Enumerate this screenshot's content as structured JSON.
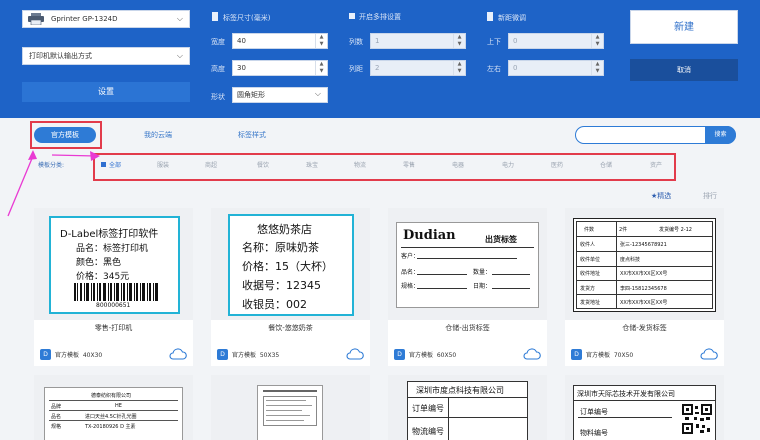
{
  "top": {
    "printer": "Gprinter  GP-1324D",
    "print_mode": "打印机默认输出方式",
    "settings_button": "设置",
    "size_heading": "标签尺寸(毫米)",
    "width_label": "宽度",
    "width_value": "40",
    "height_label": "高度",
    "height_value": "30",
    "shape_label": "形状",
    "shape_value": "圆角矩形",
    "multi_heading": "开启多排设置",
    "cols_label": "列数",
    "cols_value": "1",
    "colgap_label": "列距",
    "colgap_value": "2",
    "offset_heading": "新距微调",
    "ud_label": "上下",
    "ud_value": "0",
    "lr_label": "左右",
    "lr_value": "0",
    "new_button": "新建",
    "cancel_button": "取消"
  },
  "tabs": {
    "official": "官方模板",
    "cloud": "我的云端",
    "tag_rules": "标签样式"
  },
  "search": {
    "button": "搜索"
  },
  "categories": {
    "label": "模板分类:",
    "items": [
      "全部",
      "服装",
      "商超",
      "餐饮",
      "珠宝",
      "物流",
      "零售",
      "电器",
      "电力",
      "医药",
      "仓储",
      "资产"
    ]
  },
  "sort": {
    "featured": "★精选",
    "rank": "排行"
  },
  "cards": [
    {
      "caption": "零售-打印机",
      "source": "官方模板",
      "size": "40X30",
      "lines": [
        "D-Label标签打印软件",
        "品名：标签打印机",
        "颜色：黑色",
        "价格：345元",
        "800000651"
      ]
    },
    {
      "caption": "餐饮-悠悠奶茶",
      "source": "官方模板",
      "size": "50X35",
      "lines": [
        "悠悠奶茶店",
        "名称：原味奶茶",
        "价格：15（大杯）",
        "收据号：12345",
        "收银员：002"
      ]
    },
    {
      "caption": "仓储-出货标签",
      "source": "官方模板",
      "size": "60X50",
      "lines": [
        "Dudian",
        "出货标签",
        "客户：",
        "品名：",
        "数量：",
        "规格：",
        "日期："
      ]
    },
    {
      "caption": "仓储-发货标签",
      "source": "官方模板",
      "size": "70X50",
      "lines": [
        "件数",
        "2件",
        "发货编号 2-12",
        "收件人",
        "张三-12345678921",
        "收件单位",
        "度点科技",
        "收件地址",
        "XX市XX市XX区XX号",
        "发货方",
        "李四-15812345678",
        "发货地址",
        "XX市XX市XX区XX号"
      ]
    },
    {
      "lines": [
        "德泰纺织有限公司",
        "品牌",
        "HE",
        "品名",
        "进口天丝4.5C针孔光圈",
        "规格",
        "TX-20180926 D 主素"
      ]
    },
    {
      "lines": []
    },
    {
      "lines": [
        "深圳市度点科技有限公司",
        "订单编号",
        "物流编号"
      ]
    },
    {
      "lines": [
        "深圳市天际芯技术开发有限公司",
        "订单编号",
        "物料编号"
      ]
    }
  ],
  "colors": {
    "primary": "#1e63c7",
    "accent": "#22b3d6",
    "highlight": "#e23b4b",
    "arrow": "#e93ad3"
  }
}
